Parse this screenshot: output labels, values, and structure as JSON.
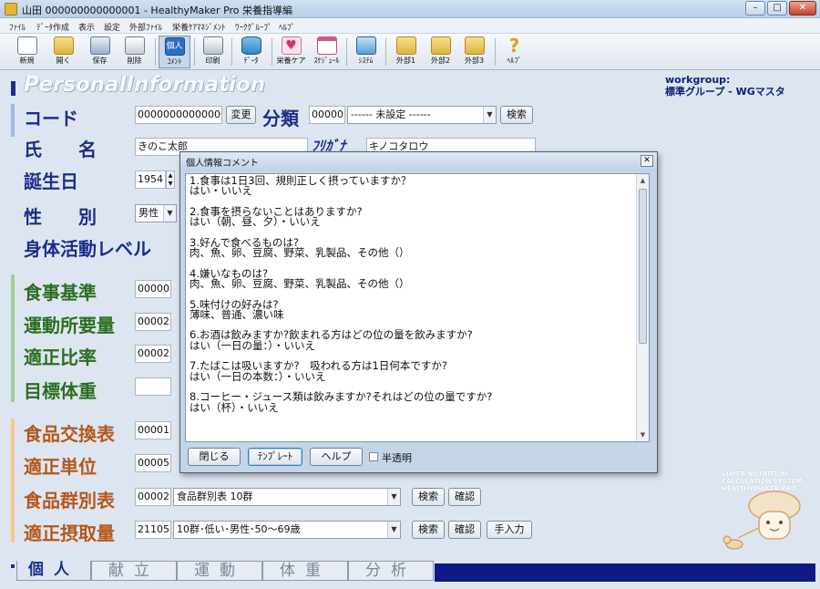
{
  "window": {
    "title": "山田 000000000000001 - HealthyMaker Pro 栄養指導編",
    "min": "–",
    "max": "□",
    "close": "✕"
  },
  "menu": [
    "ﾌｧｲﾙ",
    "ﾃﾞｰﾀ作成",
    "表示",
    "設定",
    "外部ﾌｧｲﾙ",
    "栄養ｹｱﾏﾈｼﾞﾒﾝﾄ",
    "ﾜｰｸｸﾞﾙｰﾌﾟ",
    "ﾍﾙﾌﾟ"
  ],
  "toolbar": [
    {
      "label": "新規",
      "icon": "new-file-icon"
    },
    {
      "label": "開く",
      "icon": "folder-open-icon"
    },
    {
      "label": "保存",
      "icon": "save-disk-icon"
    },
    {
      "label": "削除",
      "icon": "trash-icon"
    },
    {
      "label": "ｺﾒﾝﾄ",
      "icon": "person-comment-icon",
      "glyph": "個人"
    },
    {
      "label": "印刷",
      "icon": "printer-icon"
    },
    {
      "label": "ﾃﾞｰﾀ",
      "icon": "database-icon"
    },
    {
      "label": "栄養ケア",
      "icon": "heart-care-icon"
    },
    {
      "label": "ｽｹｼﾞｭｰﾙ",
      "icon": "calendar-icon"
    },
    {
      "label": "ｼｽﾃﾑ",
      "icon": "computer-icon"
    },
    {
      "label": "外部1",
      "icon": "folder-icon"
    },
    {
      "label": "外部2",
      "icon": "folder-icon"
    },
    {
      "label": "外部3",
      "icon": "folder-icon"
    },
    {
      "label": "ﾍﾙﾌﾟ",
      "icon": "help-icon",
      "glyph": "?"
    }
  ],
  "header": {
    "section_title": "PersonalInformation",
    "workgroup_label": "workgroup:",
    "workgroup_value": "標準グループ - WGマスタ"
  },
  "fields": {
    "code_label": "コード",
    "code_value": "000000000000001",
    "code_change_button": "変更",
    "category_label": "分類",
    "category_code": "00000",
    "category_select": "------ 未設定 ------",
    "category_search_button": "検索",
    "name_label": "氏　　名",
    "name_value": "きのこ太郎",
    "kana_label": "ﾌﾘｶﾞﾅ",
    "kana_value": "キノコタロウ",
    "birth_label": "誕生日",
    "birth_year": "1954",
    "sex_label": "性　　別",
    "sex_value": "男性",
    "activity_label": "身体活動レベル",
    "meal_standard_label": "食事基準",
    "meal_standard_code": "00000",
    "exercise_label": "運動所要量",
    "exercise_code": "00002",
    "ratio_label": "適正比率",
    "ratio_code": "00002",
    "target_weight_label": "目標体重",
    "exchange_label": "食品交換表",
    "exchange_code": "00001",
    "unit_label": "適正単位",
    "unit_code": "00005",
    "food_group_label": "食品群別表",
    "food_group_code": "00002",
    "food_group_select": "食品群別表 10群",
    "food_group_search": "検索",
    "food_group_confirm": "確認",
    "intake_label": "適正摂取量",
    "intake_code": "21105",
    "intake_select": "10群･低い･男性･50～69歳",
    "intake_search": "検索",
    "intake_confirm": "確認",
    "intake_manual": "手入力"
  },
  "tabs": [
    "個人",
    "献立",
    "運動",
    "体重",
    "分析"
  ],
  "mascot_text": [
    "SUPER NUTRITION",
    "CALCULATION SYSTEM",
    "HEALTHYMAKER PRO"
  ],
  "dialog": {
    "title": "個人情報コメント",
    "close": "✕",
    "lines": [
      "1.食事は1日3回、規則正しく摂っていますか？",
      "はい・いいえ",
      "",
      "2.食事を摂らないことはありますか?",
      "はい（朝、昼、夕）・いいえ",
      "",
      "3.好んで食べるものは?",
      "肉、魚、卵、豆腐、野菜、乳製品、その他（）",
      "",
      "4.嫌いなものは?",
      "肉、魚、卵、豆腐、野菜、乳製品、その他（）",
      "",
      "5.味付けの好みは?",
      "薄味、普通、濃い味",
      "",
      "6.お酒は飲みますか?飲まれる方はどの位の量を飲みますか?",
      "はい（一日の量：）・いいえ",
      "",
      "7.たばこは吸いますか?　吸われる方は1日何本ですか?",
      "はい（一日の本数：）・いいえ",
      "",
      "8.コーヒー・ジュース類は飲みますか?それはどの位の量ですか?",
      "はい（杯）・いいえ"
    ],
    "buttons": {
      "close": "閉じる",
      "template": "ﾃﾝﾌﾟﾚｰﾄ",
      "help": "ヘルプ"
    },
    "translucent_label": "半透明"
  }
}
